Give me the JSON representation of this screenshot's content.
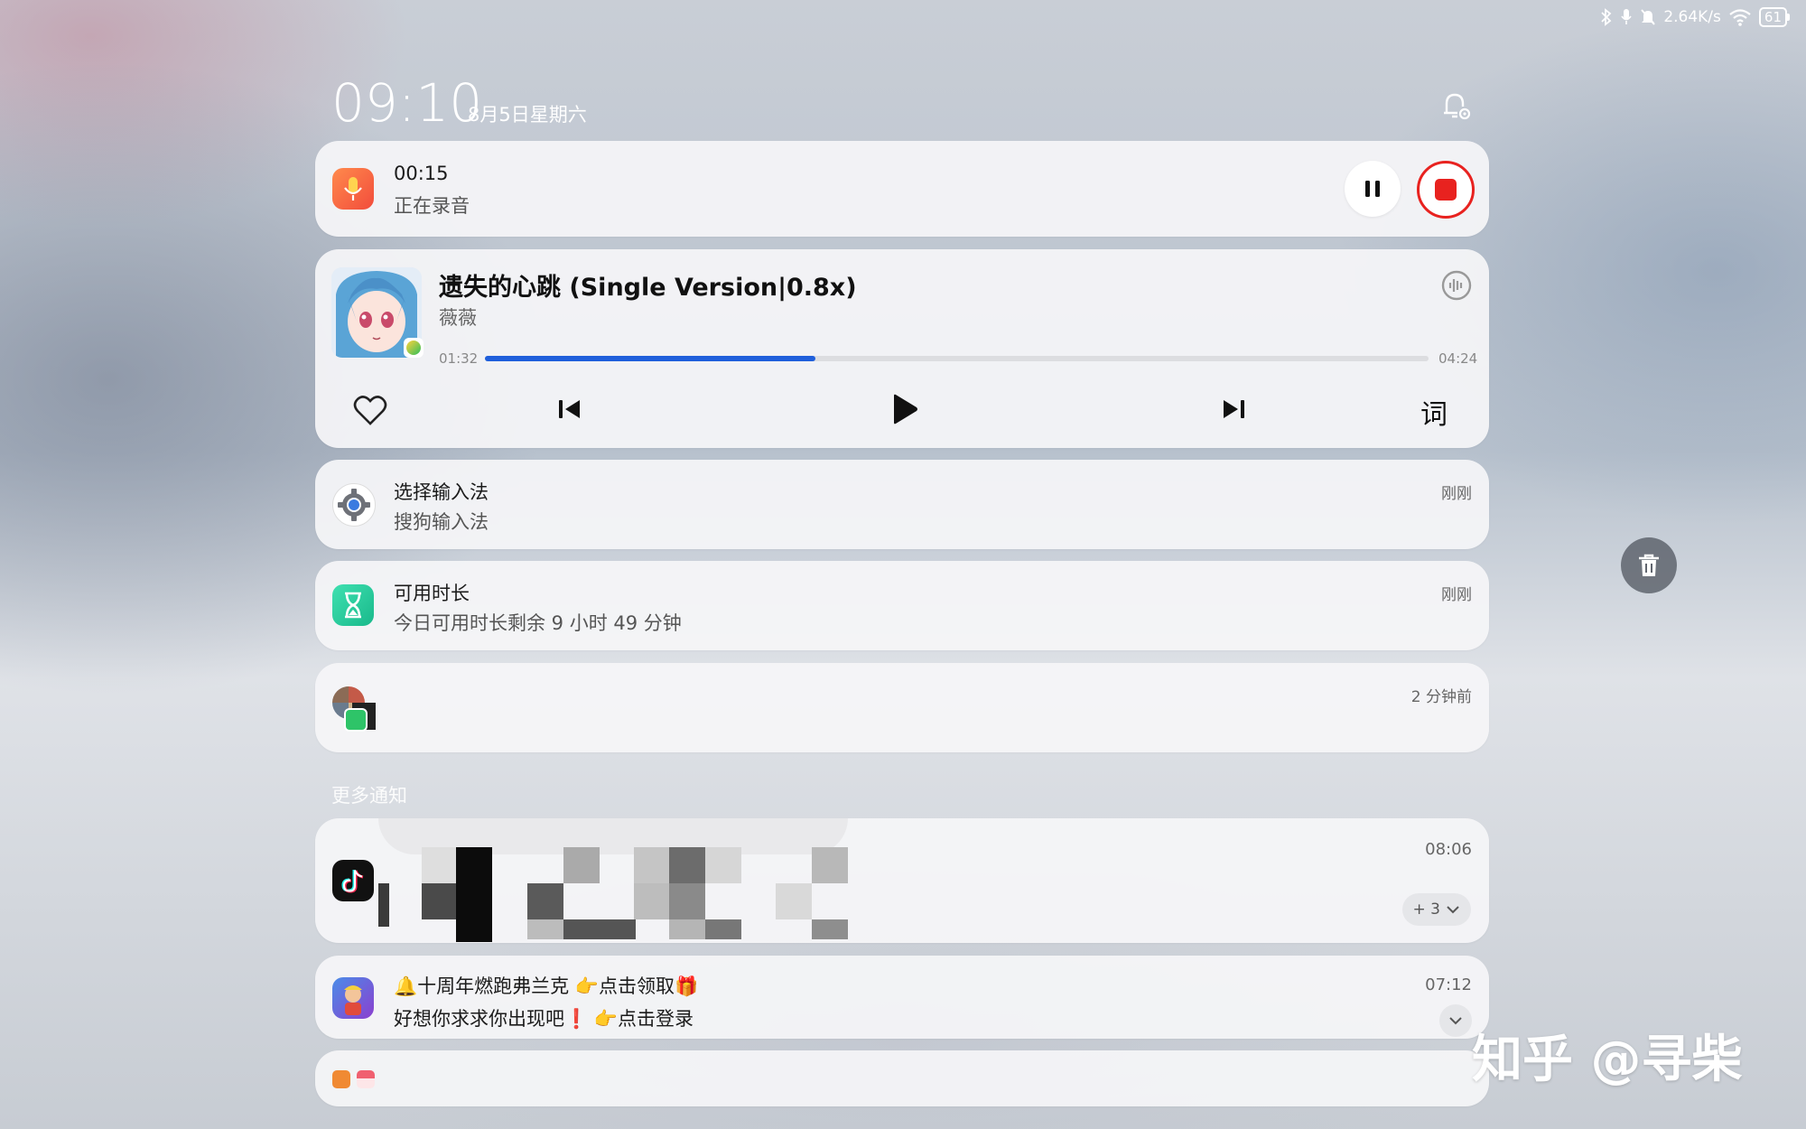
{
  "status_bar": {
    "speed": "2.64K/s",
    "battery": "61",
    "icons": [
      "bluetooth-icon",
      "mic-icon",
      "mute-icon",
      "wifi-icon",
      "battery-icon"
    ]
  },
  "header": {
    "time": "09:10",
    "date": "8月5日星期六",
    "settings_icon": "bell-gear-icon"
  },
  "recording": {
    "time": "00:15",
    "status": "正在录音",
    "icon": "microphone-icon",
    "accent": "#f5503a",
    "stop_color": "#e8221f"
  },
  "music": {
    "title": "遗失的心跳 (Single Version|0.8x)",
    "artist": "薇薇",
    "elapsed": "01:32",
    "duration": "04:24",
    "progress": 0.35,
    "lyrics_label": "词",
    "progress_color": "#1f5fdb",
    "controls": [
      "heart-icon",
      "previous-icon",
      "play-icon",
      "next-icon",
      "lyrics-button"
    ]
  },
  "notifications": [
    {
      "app": "settings",
      "title": "选择输入法",
      "body": "搜狗输入法",
      "time": "刚刚"
    },
    {
      "app": "screen-time",
      "title": "可用时长",
      "body": "今日可用时长剩余 9 小时 49 分钟",
      "time": "刚刚"
    },
    {
      "app": "wechat-group",
      "title": "",
      "body": "",
      "time": "2 分钟前"
    }
  ],
  "more_label": "更多通知",
  "more_notifications": [
    {
      "app": "douyin",
      "time": "08:06",
      "count": "+ 3"
    },
    {
      "app": "subway-surfers",
      "title": "🔔十周年燃跑弗兰克 👉点击领取🎁",
      "body": "好想你求求你出现吧❗ 👉点击登录",
      "time": "07:12"
    }
  ],
  "watermark": "知乎 @寻柴"
}
